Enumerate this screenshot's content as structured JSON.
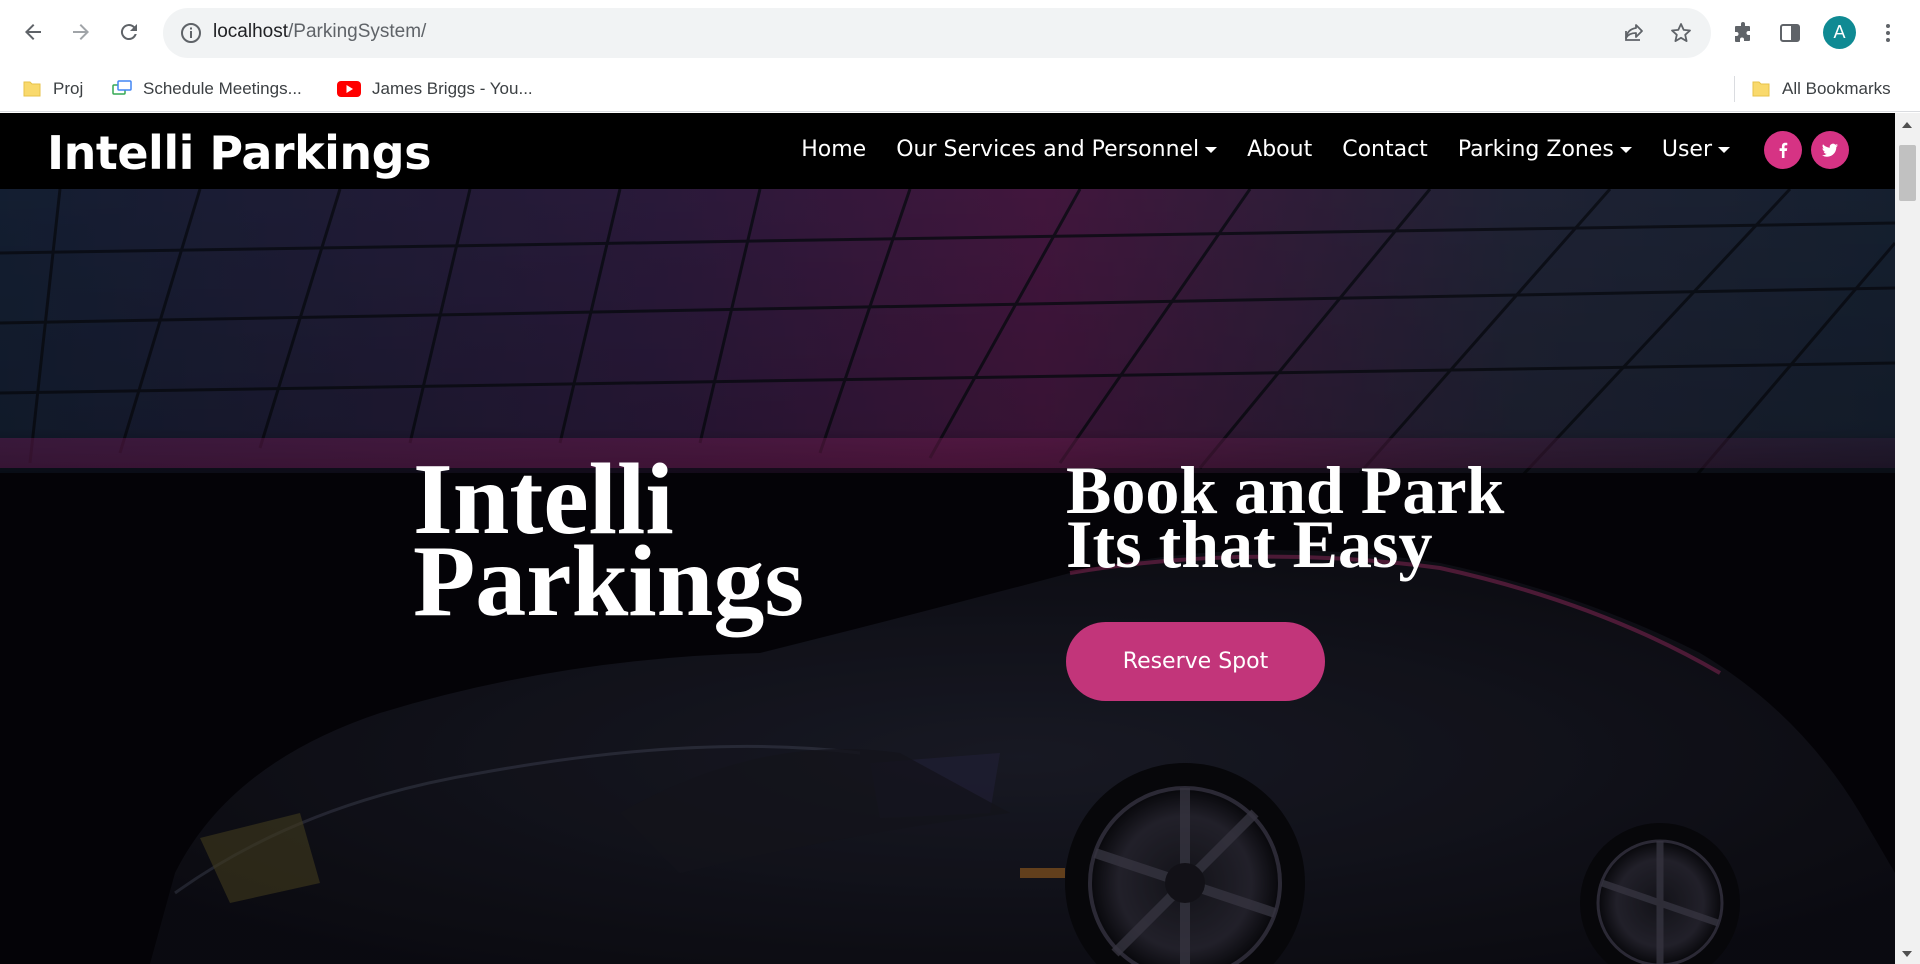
{
  "browser": {
    "url_host": "localhost",
    "url_path": "/ParkingSystem/",
    "avatar_letter": "A",
    "accent": "#0f8a93",
    "icons": [
      "back-arrow-icon",
      "forward-arrow-icon",
      "reload-icon",
      "site-info-icon",
      "share-icon",
      "star-icon",
      "extensions-icon",
      "side-panel-icon",
      "menu-dots-icon"
    ]
  },
  "bookmarks": {
    "items": [
      {
        "label": "Proj",
        "icon": "folder-icon"
      },
      {
        "label": "Schedule Meetings...",
        "icon": "meetings-icon"
      },
      {
        "label": "James Briggs - You...",
        "icon": "youtube-icon"
      }
    ],
    "all_label": "All Bookmarks"
  },
  "site": {
    "brand": "Intelli Parkings",
    "nav": [
      {
        "label": "Home",
        "dropdown": false
      },
      {
        "label": "Our Services and Personnel",
        "dropdown": true
      },
      {
        "label": "About",
        "dropdown": false
      },
      {
        "label": "Contact",
        "dropdown": false
      },
      {
        "label": "Parking Zones",
        "dropdown": true
      },
      {
        "label": "User",
        "dropdown": true
      }
    ],
    "social": [
      "facebook-icon",
      "twitter-icon"
    ],
    "accent": "#d63384"
  },
  "hero": {
    "title_line1": "Intelli",
    "title_line2": "Parkings",
    "sub_line1": "Book and Park",
    "sub_line2": "Its that Easy",
    "cta": "Reserve Spot",
    "cta_color": "#c2357a"
  }
}
